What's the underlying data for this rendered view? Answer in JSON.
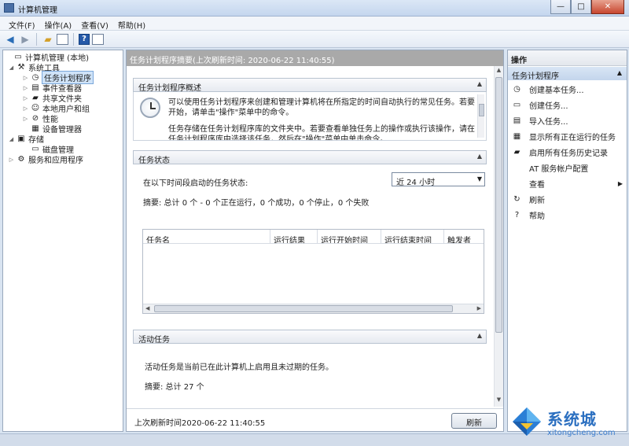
{
  "window": {
    "title": "计算机管理",
    "min": "—",
    "max": "□",
    "close": "✕"
  },
  "menu": [
    "文件(F)",
    "操作(A)",
    "查看(V)",
    "帮助(H)"
  ],
  "tree": [
    {
      "label": "计算机管理 (本地)",
      "icon": "computer-icon",
      "glyph": "▭",
      "level": 0,
      "expander": ""
    },
    {
      "label": "系统工具",
      "icon": "tools-icon",
      "glyph": "⚒",
      "level": 1,
      "expander": "◢"
    },
    {
      "label": "任务计划程序",
      "icon": "clock-icon",
      "glyph": "◷",
      "level": 2,
      "expander": "▷",
      "selected": true
    },
    {
      "label": "事件查看器",
      "icon": "event-viewer-icon",
      "glyph": "▤",
      "level": 2,
      "expander": "▷"
    },
    {
      "label": "共享文件夹",
      "icon": "shared-folder-icon",
      "glyph": "▰",
      "level": 2,
      "expander": "▷"
    },
    {
      "label": "本地用户和组",
      "icon": "users-icon",
      "glyph": "☺",
      "level": 2,
      "expander": "▷"
    },
    {
      "label": "性能",
      "icon": "performance-icon",
      "glyph": "⊘",
      "level": 2,
      "expander": "▷"
    },
    {
      "label": "设备管理器",
      "icon": "device-manager-icon",
      "glyph": "▦",
      "level": 2,
      "expander": ""
    },
    {
      "label": "存储",
      "icon": "storage-icon",
      "glyph": "▣",
      "level": 1,
      "expander": "◢"
    },
    {
      "label": "磁盘管理",
      "icon": "disk-icon",
      "glyph": "▭",
      "level": 2,
      "expander": ""
    },
    {
      "label": "服务和应用程序",
      "icon": "services-icon",
      "glyph": "⚙",
      "level": 1,
      "expander": "▷"
    }
  ],
  "center": {
    "header": "任务计划程序摘要(上次刷新时间: 2020-06-22 11:40:55)",
    "overview": {
      "title": "任务计划程序概述",
      "p1": "可以使用任务计划程序来创建和管理计算机将在所指定的时间自动执行的常见任务。若要开始，请单击\"操作\"菜单中的命令。",
      "p2": "任务存储在任务计划程序库的文件夹中。若要查看单独任务上的操作或执行该操作，请在任务计划程序库中选择该任务，然后在\"操作\"菜单中单击命令。"
    },
    "status": {
      "title": "任务状态",
      "label": "在以下时间段启动的任务状态:",
      "period": "近 24 小时",
      "summary": "摘要: 总计 0 个 - 0 个正在运行，0 个成功，0 个停止，0 个失败",
      "columns": [
        "任务名",
        "运行结果",
        "运行开始时间",
        "运行结束时间",
        "触发者"
      ]
    },
    "active": {
      "title": "活动任务",
      "text": "活动任务是当前已在此计算机上启用且未过期的任务。",
      "summary": "摘要: 总计 27 个"
    },
    "footer": {
      "last_refresh": "上次刷新时间2020-06-22 11:40:55",
      "refresh": "刷新"
    }
  },
  "actions": {
    "title": "操作",
    "section": "任务计划程序",
    "items": [
      {
        "label": "创建基本任务...",
        "icon": "create-basic-task-icon",
        "glyph": "◷"
      },
      {
        "label": "创建任务...",
        "icon": "create-task-icon",
        "glyph": "▭"
      },
      {
        "label": "导入任务...",
        "icon": "import-task-icon",
        "glyph": "▤"
      },
      {
        "label": "显示所有正在运行的任务",
        "icon": "running-tasks-icon",
        "glyph": "▦"
      },
      {
        "label": "启用所有任务历史记录",
        "icon": "history-icon",
        "glyph": "▰"
      },
      {
        "label": "AT 服务帐户配置",
        "icon": "blank-icon",
        "glyph": ""
      },
      {
        "label": "查看",
        "icon": "blank-icon",
        "glyph": "",
        "submenu": true
      },
      {
        "label": "刷新",
        "icon": "refresh-icon",
        "glyph": "↻"
      },
      {
        "label": "帮助",
        "icon": "help-icon",
        "glyph": "?"
      }
    ]
  },
  "watermark": {
    "brand": "系统城",
    "url": "xitongcheng.com"
  }
}
